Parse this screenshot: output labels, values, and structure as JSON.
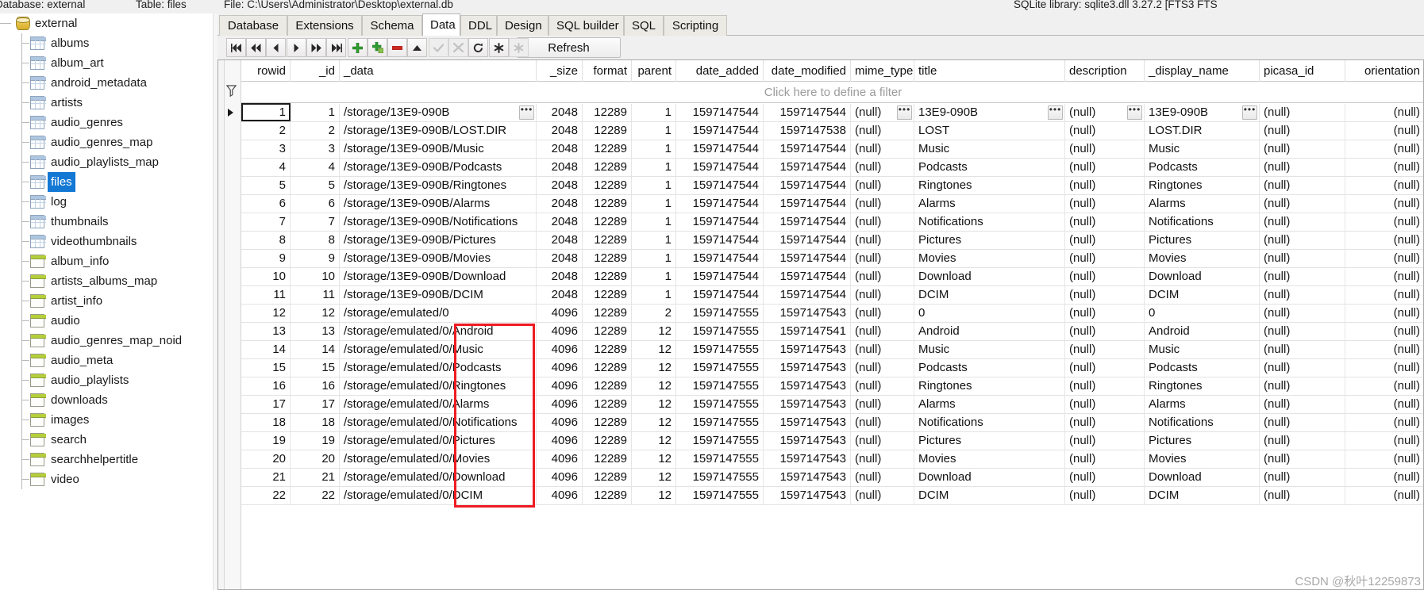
{
  "statusbar": {
    "database_label": "Database: external",
    "table_label": "Table: files",
    "file_label": "File: C:\\Users\\Administrator\\Desktop\\external.db",
    "library_label": "SQLite library: sqlite3.dll 3.27.2 [FTS3 FTS"
  },
  "tree": {
    "root": {
      "label": "external",
      "icon": "database-icon"
    },
    "items": [
      {
        "label": "albums",
        "icon": "table-icon",
        "selected": false
      },
      {
        "label": "album_art",
        "icon": "table-icon",
        "selected": false
      },
      {
        "label": "android_metadata",
        "icon": "table-icon",
        "selected": false
      },
      {
        "label": "artists",
        "icon": "table-icon",
        "selected": false
      },
      {
        "label": "audio_genres",
        "icon": "table-icon",
        "selected": false
      },
      {
        "label": "audio_genres_map",
        "icon": "table-icon",
        "selected": false
      },
      {
        "label": "audio_playlists_map",
        "icon": "table-icon",
        "selected": false
      },
      {
        "label": "files",
        "icon": "table-icon",
        "selected": true
      },
      {
        "label": "log",
        "icon": "table-icon",
        "selected": false
      },
      {
        "label": "thumbnails",
        "icon": "table-icon",
        "selected": false
      },
      {
        "label": "videothumbnails",
        "icon": "table-icon",
        "selected": false
      },
      {
        "label": "album_info",
        "icon": "view-icon",
        "selected": false
      },
      {
        "label": "artists_albums_map",
        "icon": "view-icon",
        "selected": false
      },
      {
        "label": "artist_info",
        "icon": "view-icon",
        "selected": false
      },
      {
        "label": "audio",
        "icon": "view-icon",
        "selected": false
      },
      {
        "label": "audio_genres_map_noid",
        "icon": "view-icon",
        "selected": false
      },
      {
        "label": "audio_meta",
        "icon": "view-icon",
        "selected": false
      },
      {
        "label": "audio_playlists",
        "icon": "view-icon",
        "selected": false
      },
      {
        "label": "downloads",
        "icon": "view-icon",
        "selected": false
      },
      {
        "label": "images",
        "icon": "view-icon",
        "selected": false
      },
      {
        "label": "search",
        "icon": "view-icon",
        "selected": false
      },
      {
        "label": "searchhelpertitle",
        "icon": "view-icon",
        "selected": false
      },
      {
        "label": "video",
        "icon": "view-icon",
        "selected": false
      }
    ]
  },
  "tabs": [
    {
      "label": "Database",
      "active": false
    },
    {
      "label": "Extensions",
      "active": false
    },
    {
      "label": "Schema",
      "active": false
    },
    {
      "label": "Data",
      "active": true
    },
    {
      "label": "DDL",
      "active": false
    },
    {
      "label": "Design",
      "active": false
    },
    {
      "label": "SQL builder",
      "active": false
    },
    {
      "label": "SQL",
      "active": false
    },
    {
      "label": "Scripting",
      "active": false
    }
  ],
  "toolbar": {
    "refresh_label": "Refresh",
    "buttons": [
      {
        "name": "first-record-button",
        "icon": "skip-to-start-icon",
        "enabled": true
      },
      {
        "name": "prior-page-button",
        "icon": "rewind-icon",
        "enabled": true
      },
      {
        "name": "prior-record-button",
        "icon": "play-left-icon",
        "enabled": true
      },
      {
        "name": "next-record-button",
        "icon": "play-right-icon",
        "enabled": true
      },
      {
        "name": "next-page-button",
        "icon": "fast-forward-icon",
        "enabled": true
      },
      {
        "name": "last-record-button",
        "icon": "skip-to-end-icon",
        "enabled": true
      },
      {
        "name": "insert-record-button",
        "icon": "plus-icon",
        "enabled": true
      },
      {
        "name": "duplicate-record-button",
        "icon": "plus-copy-icon",
        "enabled": true
      },
      {
        "name": "delete-record-button",
        "icon": "minus-icon",
        "enabled": true
      },
      {
        "name": "edit-record-button",
        "icon": "triangle-up-icon",
        "enabled": true
      },
      {
        "name": "post-edit-button",
        "icon": "check-icon",
        "enabled": false
      },
      {
        "name": "cancel-edit-button",
        "icon": "cancel-x-icon",
        "enabled": false
      },
      {
        "name": "refresh-record-button",
        "icon": "reload-icon",
        "enabled": true
      },
      {
        "name": "set-null-button",
        "icon": "asterisk-icon",
        "enabled": true
      },
      {
        "name": "clear-null-button",
        "icon": "asterisk-dim-icon",
        "enabled": false
      }
    ]
  },
  "grid": {
    "filter_hint": "Click here to define a filter",
    "filter_icon": "funnel-icon",
    "columns": [
      {
        "key": "rowid",
        "label": "rowid",
        "align": "right"
      },
      {
        "key": "_id",
        "label": "_id",
        "align": "right"
      },
      {
        "key": "_data",
        "label": "_data",
        "align": "left"
      },
      {
        "key": "_size",
        "label": "_size",
        "align": "right"
      },
      {
        "key": "format",
        "label": "format",
        "align": "right"
      },
      {
        "key": "parent",
        "label": "parent",
        "align": "right"
      },
      {
        "key": "date_added",
        "label": "date_added",
        "align": "right"
      },
      {
        "key": "date_modified",
        "label": "date_modified",
        "align": "right"
      },
      {
        "key": "mime_type",
        "label": "mime_type",
        "align": "left"
      },
      {
        "key": "title",
        "label": "title",
        "align": "left"
      },
      {
        "key": "description",
        "label": "description",
        "align": "left"
      },
      {
        "key": "_display_name",
        "label": "_display_name",
        "align": "left"
      },
      {
        "key": "picasa_id",
        "label": "picasa_id",
        "align": "left"
      },
      {
        "key": "orientation",
        "label": "orientation",
        "align": "right"
      }
    ],
    "selected_row_index": 0,
    "rows": [
      {
        "rowid": "1",
        "_id": "1",
        "_data": "/storage/13E9-090B",
        "_size": "2048",
        "format": "12289",
        "parent": "1",
        "date_added": "1597147544",
        "date_modified": "1597147544",
        "mime_type": "(null)",
        "title": "13E9-090B",
        "description": "(null)",
        "_display_name": "13E9-090B",
        "picasa_id": "(null)",
        "orientation": "(null)"
      },
      {
        "rowid": "2",
        "_id": "2",
        "_data": "/storage/13E9-090B/LOST.DIR",
        "_size": "2048",
        "format": "12289",
        "parent": "1",
        "date_added": "1597147544",
        "date_modified": "1597147538",
        "mime_type": "(null)",
        "title": "LOST",
        "description": "(null)",
        "_display_name": "LOST.DIR",
        "picasa_id": "(null)",
        "orientation": "(null)"
      },
      {
        "rowid": "3",
        "_id": "3",
        "_data": "/storage/13E9-090B/Music",
        "_size": "2048",
        "format": "12289",
        "parent": "1",
        "date_added": "1597147544",
        "date_modified": "1597147544",
        "mime_type": "(null)",
        "title": "Music",
        "description": "(null)",
        "_display_name": "Music",
        "picasa_id": "(null)",
        "orientation": "(null)"
      },
      {
        "rowid": "4",
        "_id": "4",
        "_data": "/storage/13E9-090B/Podcasts",
        "_size": "2048",
        "format": "12289",
        "parent": "1",
        "date_added": "1597147544",
        "date_modified": "1597147544",
        "mime_type": "(null)",
        "title": "Podcasts",
        "description": "(null)",
        "_display_name": "Podcasts",
        "picasa_id": "(null)",
        "orientation": "(null)"
      },
      {
        "rowid": "5",
        "_id": "5",
        "_data": "/storage/13E9-090B/Ringtones",
        "_size": "2048",
        "format": "12289",
        "parent": "1",
        "date_added": "1597147544",
        "date_modified": "1597147544",
        "mime_type": "(null)",
        "title": "Ringtones",
        "description": "(null)",
        "_display_name": "Ringtones",
        "picasa_id": "(null)",
        "orientation": "(null)"
      },
      {
        "rowid": "6",
        "_id": "6",
        "_data": "/storage/13E9-090B/Alarms",
        "_size": "2048",
        "format": "12289",
        "parent": "1",
        "date_added": "1597147544",
        "date_modified": "1597147544",
        "mime_type": "(null)",
        "title": "Alarms",
        "description": "(null)",
        "_display_name": "Alarms",
        "picasa_id": "(null)",
        "orientation": "(null)"
      },
      {
        "rowid": "7",
        "_id": "7",
        "_data": "/storage/13E9-090B/Notifications",
        "_size": "2048",
        "format": "12289",
        "parent": "1",
        "date_added": "1597147544",
        "date_modified": "1597147544",
        "mime_type": "(null)",
        "title": "Notifications",
        "description": "(null)",
        "_display_name": "Notifications",
        "picasa_id": "(null)",
        "orientation": "(null)"
      },
      {
        "rowid": "8",
        "_id": "8",
        "_data": "/storage/13E9-090B/Pictures",
        "_size": "2048",
        "format": "12289",
        "parent": "1",
        "date_added": "1597147544",
        "date_modified": "1597147544",
        "mime_type": "(null)",
        "title": "Pictures",
        "description": "(null)",
        "_display_name": "Pictures",
        "picasa_id": "(null)",
        "orientation": "(null)"
      },
      {
        "rowid": "9",
        "_id": "9",
        "_data": "/storage/13E9-090B/Movies",
        "_size": "2048",
        "format": "12289",
        "parent": "1",
        "date_added": "1597147544",
        "date_modified": "1597147544",
        "mime_type": "(null)",
        "title": "Movies",
        "description": "(null)",
        "_display_name": "Movies",
        "picasa_id": "(null)",
        "orientation": "(null)"
      },
      {
        "rowid": "10",
        "_id": "10",
        "_data": "/storage/13E9-090B/Download",
        "_size": "2048",
        "format": "12289",
        "parent": "1",
        "date_added": "1597147544",
        "date_modified": "1597147544",
        "mime_type": "(null)",
        "title": "Download",
        "description": "(null)",
        "_display_name": "Download",
        "picasa_id": "(null)",
        "orientation": "(null)"
      },
      {
        "rowid": "11",
        "_id": "11",
        "_data": "/storage/13E9-090B/DCIM",
        "_size": "2048",
        "format": "12289",
        "parent": "1",
        "date_added": "1597147544",
        "date_modified": "1597147544",
        "mime_type": "(null)",
        "title": "DCIM",
        "description": "(null)",
        "_display_name": "DCIM",
        "picasa_id": "(null)",
        "orientation": "(null)"
      },
      {
        "rowid": "12",
        "_id": "12",
        "_data": "/storage/emulated/0",
        "_size": "4096",
        "format": "12289",
        "parent": "2",
        "date_added": "1597147555",
        "date_modified": "1597147543",
        "mime_type": "(null)",
        "title": "0",
        "description": "(null)",
        "_display_name": "0",
        "picasa_id": "(null)",
        "orientation": "(null)"
      },
      {
        "rowid": "13",
        "_id": "13",
        "_data": "/storage/emulated/0/Android",
        "_size": "4096",
        "format": "12289",
        "parent": "12",
        "date_added": "1597147555",
        "date_modified": "1597147541",
        "mime_type": "(null)",
        "title": "Android",
        "description": "(null)",
        "_display_name": "Android",
        "picasa_id": "(null)",
        "orientation": "(null)"
      },
      {
        "rowid": "14",
        "_id": "14",
        "_data": "/storage/emulated/0/Music",
        "_size": "4096",
        "format": "12289",
        "parent": "12",
        "date_added": "1597147555",
        "date_modified": "1597147543",
        "mime_type": "(null)",
        "title": "Music",
        "description": "(null)",
        "_display_name": "Music",
        "picasa_id": "(null)",
        "orientation": "(null)"
      },
      {
        "rowid": "15",
        "_id": "15",
        "_data": "/storage/emulated/0/Podcasts",
        "_size": "4096",
        "format": "12289",
        "parent": "12",
        "date_added": "1597147555",
        "date_modified": "1597147543",
        "mime_type": "(null)",
        "title": "Podcasts",
        "description": "(null)",
        "_display_name": "Podcasts",
        "picasa_id": "(null)",
        "orientation": "(null)"
      },
      {
        "rowid": "16",
        "_id": "16",
        "_data": "/storage/emulated/0/Ringtones",
        "_size": "4096",
        "format": "12289",
        "parent": "12",
        "date_added": "1597147555",
        "date_modified": "1597147543",
        "mime_type": "(null)",
        "title": "Ringtones",
        "description": "(null)",
        "_display_name": "Ringtones",
        "picasa_id": "(null)",
        "orientation": "(null)"
      },
      {
        "rowid": "17",
        "_id": "17",
        "_data": "/storage/emulated/0/Alarms",
        "_size": "4096",
        "format": "12289",
        "parent": "12",
        "date_added": "1597147555",
        "date_modified": "1597147543",
        "mime_type": "(null)",
        "title": "Alarms",
        "description": "(null)",
        "_display_name": "Alarms",
        "picasa_id": "(null)",
        "orientation": "(null)"
      },
      {
        "rowid": "18",
        "_id": "18",
        "_data": "/storage/emulated/0/Notifications",
        "_size": "4096",
        "format": "12289",
        "parent": "12",
        "date_added": "1597147555",
        "date_modified": "1597147543",
        "mime_type": "(null)",
        "title": "Notifications",
        "description": "(null)",
        "_display_name": "Notifications",
        "picasa_id": "(null)",
        "orientation": "(null)"
      },
      {
        "rowid": "19",
        "_id": "19",
        "_data": "/storage/emulated/0/Pictures",
        "_size": "4096",
        "format": "12289",
        "parent": "12",
        "date_added": "1597147555",
        "date_modified": "1597147543",
        "mime_type": "(null)",
        "title": "Pictures",
        "description": "(null)",
        "_display_name": "Pictures",
        "picasa_id": "(null)",
        "orientation": "(null)"
      },
      {
        "rowid": "20",
        "_id": "20",
        "_data": "/storage/emulated/0/Movies",
        "_size": "4096",
        "format": "12289",
        "parent": "12",
        "date_added": "1597147555",
        "date_modified": "1597147543",
        "mime_type": "(null)",
        "title": "Movies",
        "description": "(null)",
        "_display_name": "Movies",
        "picasa_id": "(null)",
        "orientation": "(null)"
      },
      {
        "rowid": "21",
        "_id": "21",
        "_data": "/storage/emulated/0/Download",
        "_size": "4096",
        "format": "12289",
        "parent": "12",
        "date_added": "1597147555",
        "date_modified": "1597147543",
        "mime_type": "(null)",
        "title": "Download",
        "description": "(null)",
        "_display_name": "Download",
        "picasa_id": "(null)",
        "orientation": "(null)"
      },
      {
        "rowid": "22",
        "_id": "22",
        "_data": "/storage/emulated/0/DCIM",
        "_size": "4096",
        "format": "12289",
        "parent": "12",
        "date_added": "1597147555",
        "date_modified": "1597147543",
        "mime_type": "(null)",
        "title": "DCIM",
        "description": "(null)",
        "_display_name": "DCIM",
        "picasa_id": "(null)",
        "orientation": "(null)"
      }
    ]
  },
  "annotation": {
    "color": "#ee1b23"
  },
  "watermark": {
    "text": "CSDN @秋叶12259873"
  },
  "colors": {
    "selection": "#1278d4",
    "annotation": "#ee1b23",
    "header_bg": "#ffffff"
  }
}
